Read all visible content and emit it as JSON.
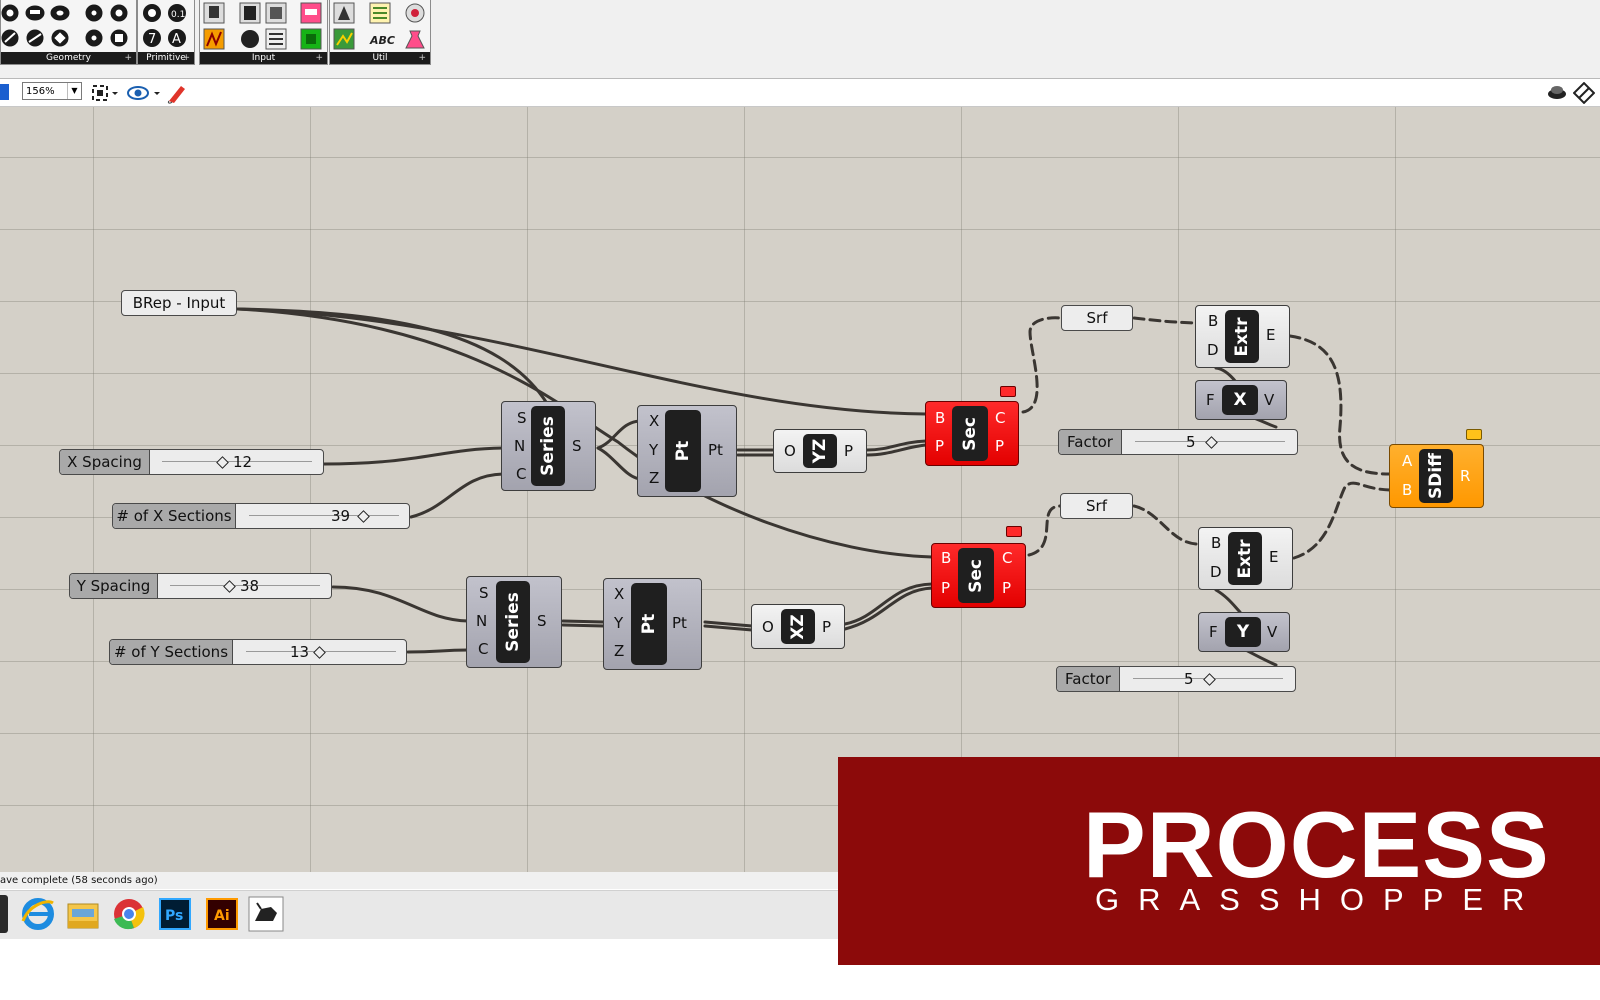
{
  "ribbon": {
    "groups": [
      {
        "label": "Geometry"
      },
      {
        "label": "Primitive"
      },
      {
        "label": "Input"
      },
      {
        "label": "Util"
      }
    ]
  },
  "toolbar": {
    "zoom": "156%"
  },
  "canvas": {
    "brep_input": "BRep - Input",
    "x_spacing": {
      "label": "X Spacing",
      "value": "12"
    },
    "x_sections": {
      "label": "# of X Sections",
      "value": "39"
    },
    "y_spacing": {
      "label": "Y Spacing",
      "value": "38"
    },
    "y_sections": {
      "label": "# of Y Sections",
      "value": "13"
    },
    "series_x": {
      "name": "Series",
      "inputs": [
        "S",
        "N",
        "C"
      ],
      "output": "S"
    },
    "series_y": {
      "name": "Series",
      "inputs": [
        "S",
        "N",
        "C"
      ],
      "output": "S"
    },
    "pt_x": {
      "name": "Pt",
      "inputs": [
        "X",
        "Y",
        "Z"
      ],
      "output": "Pt"
    },
    "pt_y": {
      "name": "Pt",
      "inputs": [
        "X",
        "Y",
        "Z"
      ],
      "output": "Pt"
    },
    "yz_plane": {
      "name": "YZ",
      "input": "O",
      "output": "P"
    },
    "xz_plane": {
      "name": "XZ",
      "input": "O",
      "output": "P"
    },
    "sec_1": {
      "name": "Sec",
      "inputs": [
        "B",
        "P"
      ],
      "outputs": [
        "C",
        "P"
      ]
    },
    "sec_2": {
      "name": "Sec",
      "inputs": [
        "B",
        "P"
      ],
      "outputs": [
        "C",
        "P"
      ]
    },
    "srf_1": "Srf",
    "srf_2": "Srf",
    "extr_1": {
      "name": "Extr",
      "inputs": [
        "B",
        "D"
      ],
      "output": "E"
    },
    "extr_2": {
      "name": "Extr",
      "inputs": [
        "B",
        "D"
      ],
      "output": "E"
    },
    "vec_x": {
      "name": "X",
      "input": "F",
      "output": "V"
    },
    "vec_y": {
      "name": "Y",
      "input": "F",
      "output": "V"
    },
    "factor_1": {
      "label": "Factor",
      "value": "5"
    },
    "factor_2": {
      "label": "Factor",
      "value": "5"
    },
    "sdiff": {
      "name": "SDiff",
      "inputs": [
        "A",
        "B"
      ],
      "output": "R"
    }
  },
  "status": "ave complete (58 seconds ago)",
  "overlay": {
    "title": "PROCESS",
    "subtitle": "GRASSHOPPER"
  },
  "colors": {
    "canvas": "#d4d0c8",
    "component_red": "#ff1a1a",
    "component_orange": "#ff9f1c",
    "overlay": "#8c0a0a"
  }
}
